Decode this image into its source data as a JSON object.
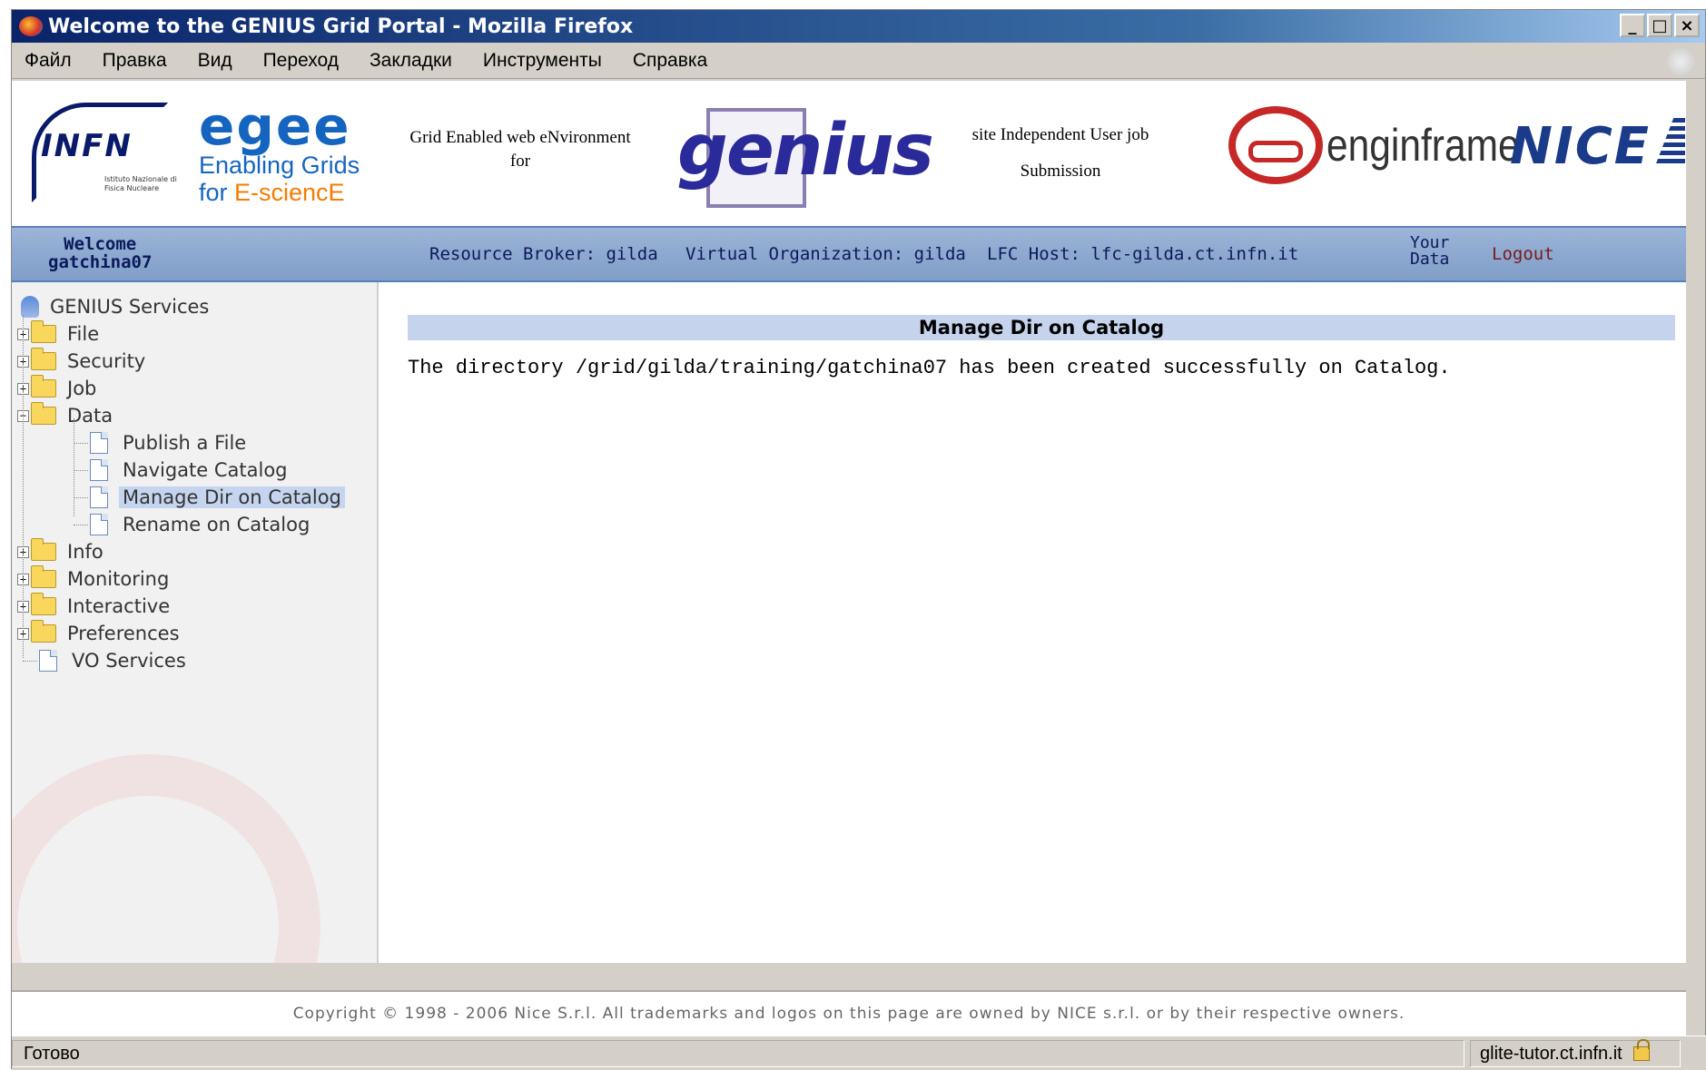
{
  "window": {
    "title": "Welcome to the GENIUS Grid Portal - Mozilla Firefox"
  },
  "menu": [
    "Файл",
    "Правка",
    "Вид",
    "Переход",
    "Закладки",
    "Инструменты",
    "Справка"
  ],
  "banner": {
    "infn": "INFN",
    "infn_sub": "Istituto Nazionale di Fisica Nucleare",
    "egee": "egee",
    "egee_line1": "Enabling Grids",
    "egee_for": "for ",
    "egee_escience": "E-sciencE",
    "genius_desc_1": "Grid Enabled web eNvironment",
    "genius_desc_2": "for",
    "genius": "genius",
    "site_desc_1": "site Independent User job",
    "site_desc_2": "Submission",
    "enginframe": "enginframe",
    "nice": "NICE"
  },
  "infobar": {
    "welcome": "Welcome",
    "user": "gatchina07",
    "resource_broker": "Resource Broker: gilda",
    "virtual_org": "Virtual Organization: gilda",
    "lfc_host": "LFC Host: lfc-gilda.ct.infn.it",
    "your": "Your",
    "data": "Data",
    "logout": "Logout"
  },
  "tree": {
    "root": "GENIUS Services",
    "file": "File",
    "security": "Security",
    "job": "Job",
    "data": "Data",
    "publish": "Publish a File",
    "navigate": "Navigate Catalog",
    "manage": "Manage Dir on Catalog",
    "rename": "Rename on Catalog",
    "info": "Info",
    "monitoring": "Monitoring",
    "interactive": "Interactive",
    "preferences": "Preferences",
    "vo_services": "VO Services"
  },
  "main": {
    "header": "Manage Dir on Catalog",
    "message": "The directory /grid/gilda/training/gatchina07 has been created successfully on Catalog."
  },
  "footer": "Copyright © 1998 - 2006 Nice S.r.l. All trademarks and logos on this page are owned by NICE s.r.l. or by their respective owners.",
  "status": {
    "text": "Готово",
    "host": "glite-tutor.ct.infn.it"
  }
}
